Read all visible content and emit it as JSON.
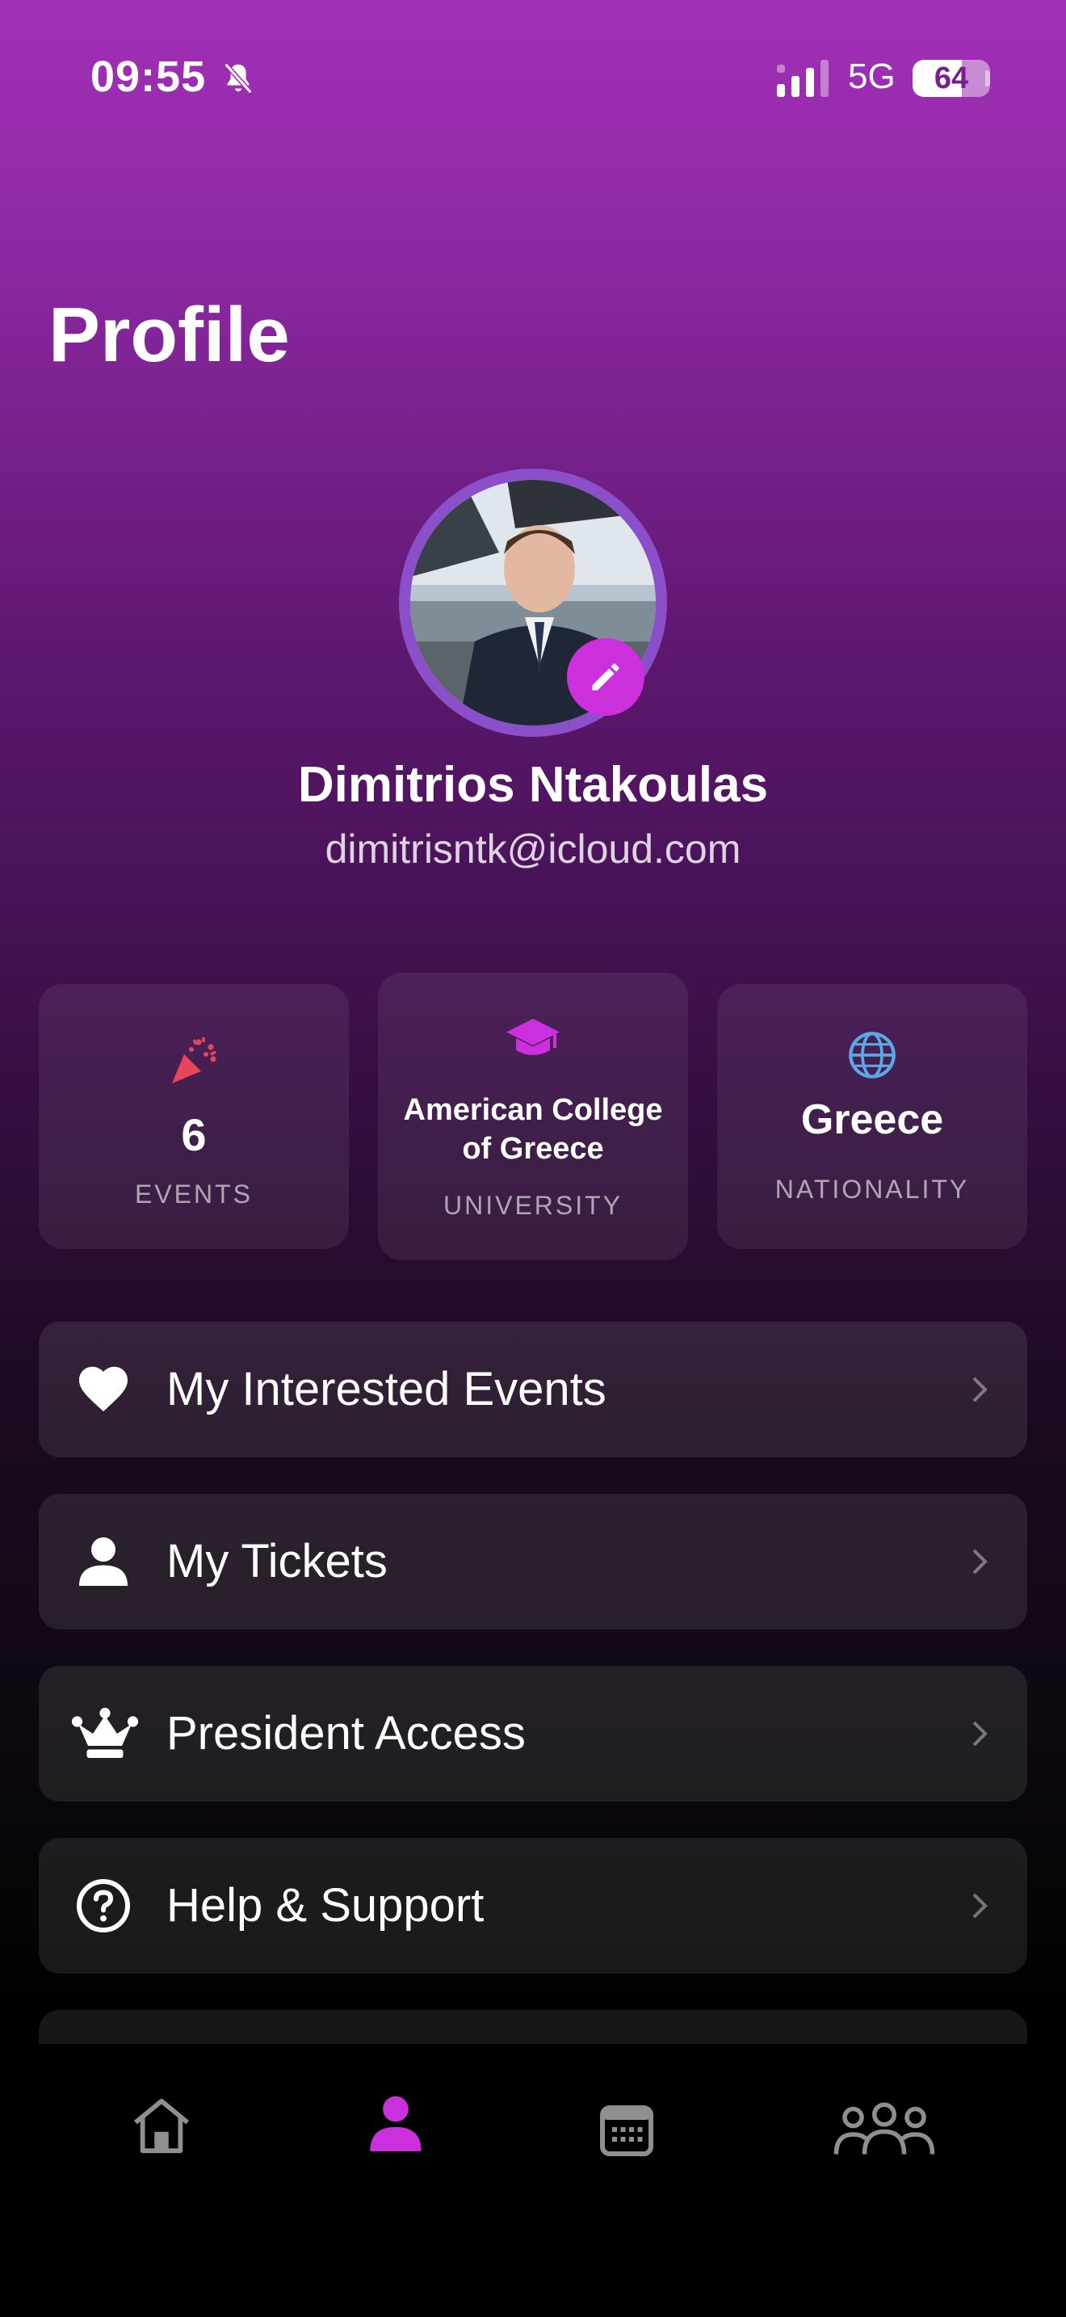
{
  "status_bar": {
    "time": "09:55",
    "network": "5G",
    "battery_percent": 64
  },
  "page": {
    "title": "Profile"
  },
  "profile": {
    "name": "Dimitrios Ntakoulas",
    "email": "dimitrisntk@icloud.com"
  },
  "stats": {
    "events": {
      "value": "6",
      "label": "EVENTS",
      "icon": "party-popper-icon"
    },
    "university": {
      "value_line1": "American College",
      "value_line2": "of Greece",
      "label": "UNIVERSITY",
      "icon": "graduation-cap-icon"
    },
    "nationality": {
      "value": "Greece",
      "label": "NATIONALITY",
      "icon": "globe-icon"
    }
  },
  "menu": {
    "items": [
      {
        "label": "My Interested Events",
        "icon": "heart-icon"
      },
      {
        "label": "My Tickets",
        "icon": "person-icon"
      },
      {
        "label": "President Access",
        "icon": "crown-icon"
      },
      {
        "label": "Help & Support",
        "icon": "question-circle-icon"
      }
    ]
  },
  "tab_bar": {
    "tabs": [
      {
        "name": "home",
        "icon": "home-icon",
        "active": false
      },
      {
        "name": "profile",
        "icon": "person-icon",
        "active": true
      },
      {
        "name": "calendar",
        "icon": "calendar-icon",
        "active": false
      },
      {
        "name": "community",
        "icon": "group-icon",
        "active": false
      }
    ]
  },
  "colors": {
    "accent": "#cc2fdc",
    "avatar_ring": "#8b4fc9",
    "party_icon": "#e8455a",
    "globe_icon": "#5aa8e6"
  }
}
